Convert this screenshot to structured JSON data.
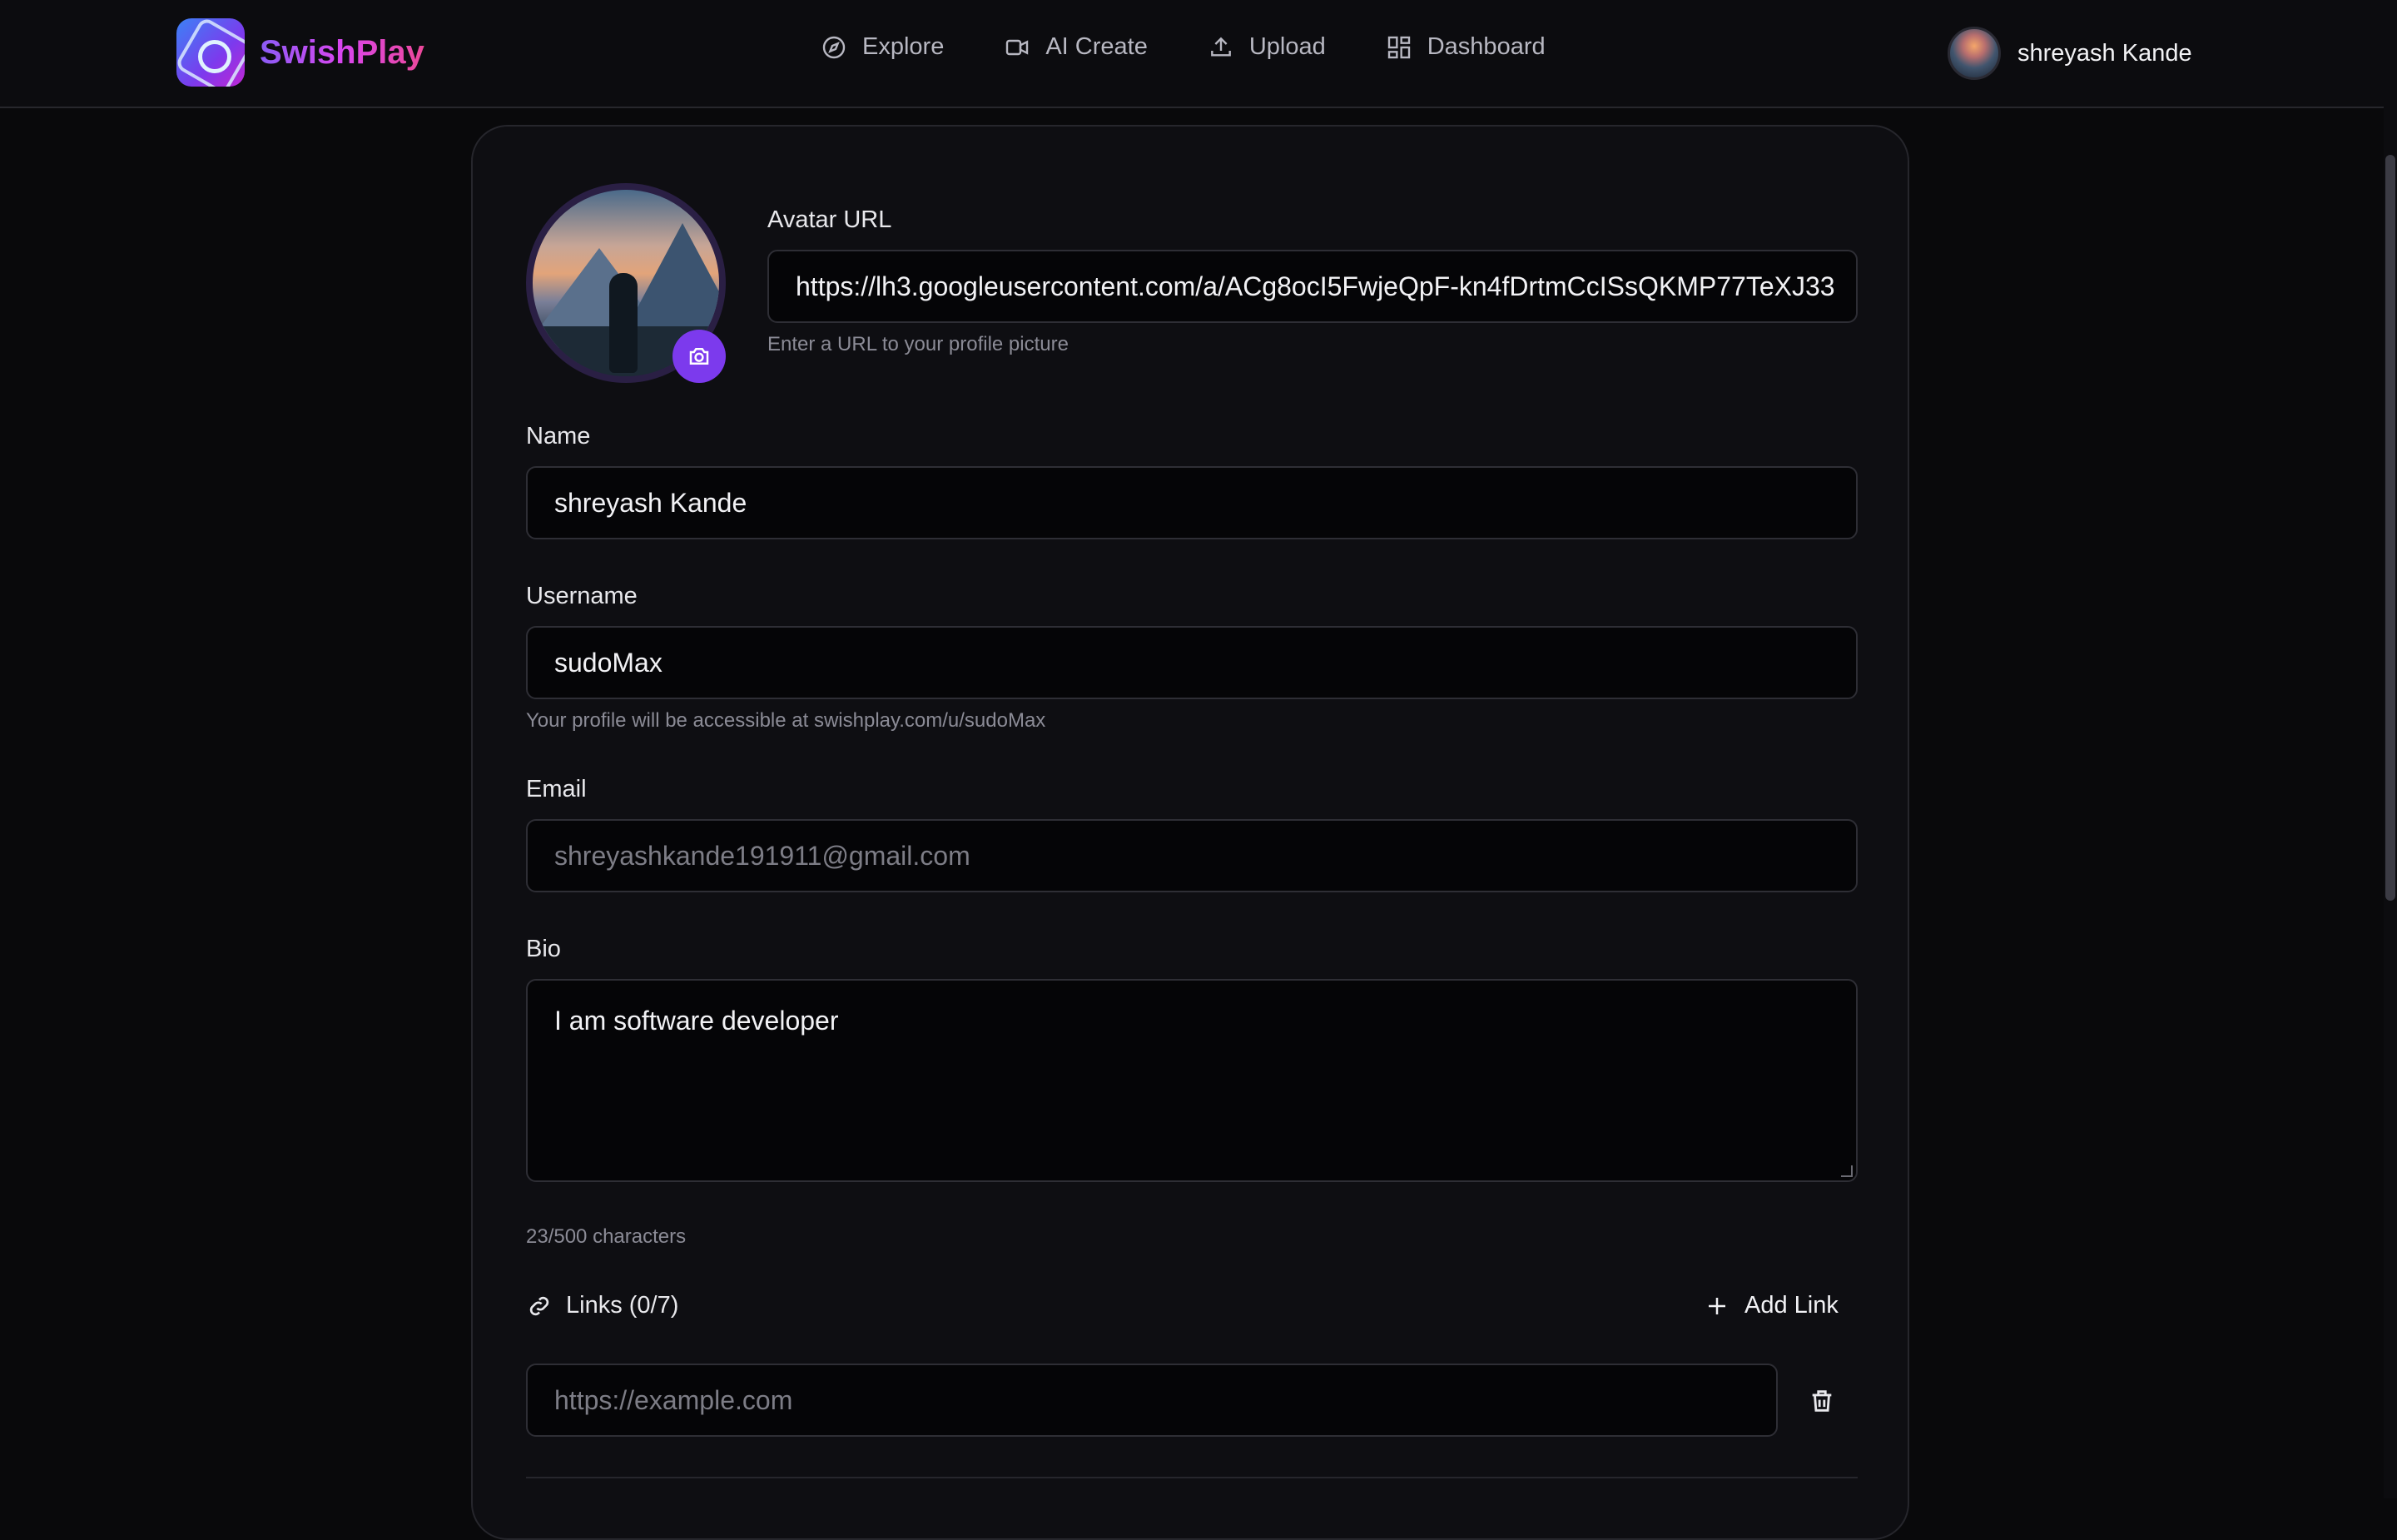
{
  "brand": {
    "name": "SwishPlay"
  },
  "nav": [
    {
      "label": "Explore",
      "icon": "compass-icon"
    },
    {
      "label": "AI Create",
      "icon": "video-icon"
    },
    {
      "label": "Upload",
      "icon": "upload-icon"
    },
    {
      "label": "Dashboard",
      "icon": "grid-icon"
    }
  ],
  "user": {
    "name": "shreyash Kande"
  },
  "form": {
    "avatar_url": {
      "label": "Avatar URL",
      "value": "https://lh3.googleusercontent.com/a/ACg8ocI5FwjeQpF-kn4fDrtmCcISsQKMP77TeXJ33",
      "hint": "Enter a URL to your profile picture"
    },
    "name": {
      "label": "Name",
      "value": "shreyash Kande"
    },
    "username": {
      "label": "Username",
      "value": "sudoMax",
      "hint": "Your profile will be accessible at swishplay.com/u/sudoMax"
    },
    "email": {
      "label": "Email",
      "value": "shreyashkande191911@gmail.com"
    },
    "bio": {
      "label": "Bio",
      "value": "I am software developer",
      "counter": "23/500 characters"
    },
    "links": {
      "title": "Links (0/7)",
      "add_label": "Add Link",
      "placeholder": "https://example.com"
    }
  },
  "colors": {
    "accent": "#7c3aed",
    "background": "#09090b",
    "card": "#0e0e12"
  }
}
